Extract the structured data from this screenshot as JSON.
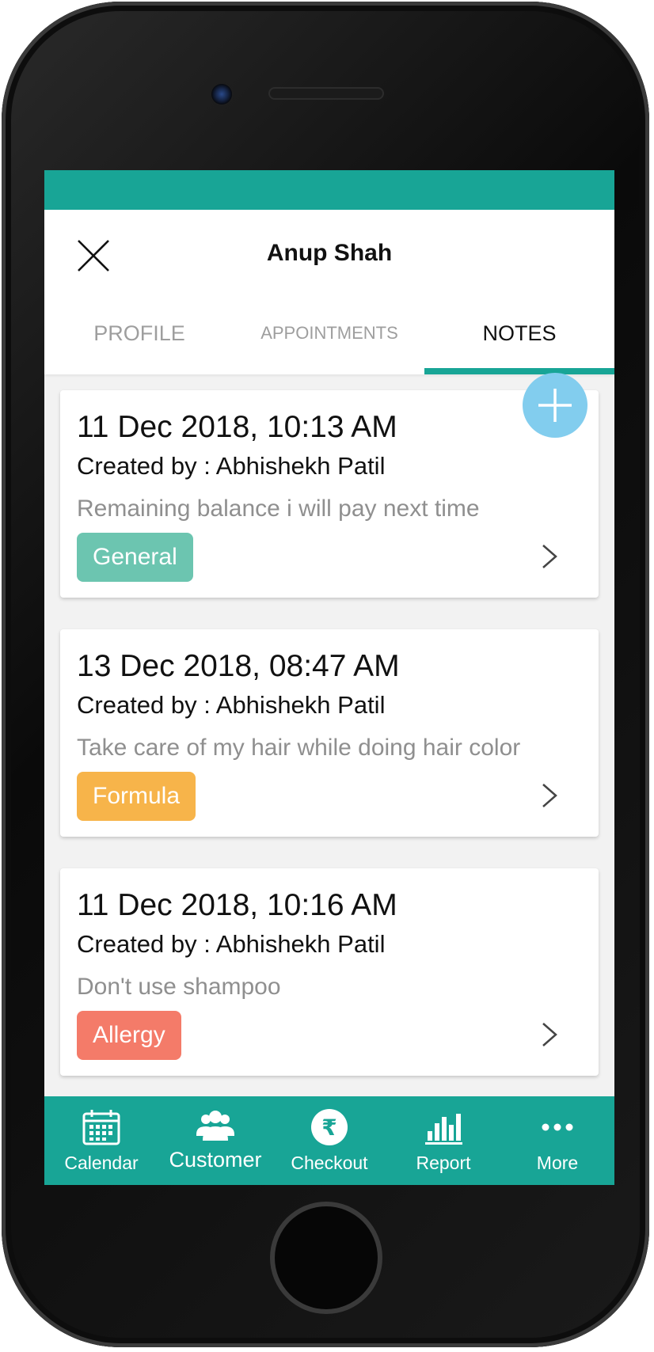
{
  "header": {
    "title": "Anup Shah",
    "close_icon": "close-icon"
  },
  "tabs": [
    {
      "label": "PROFILE",
      "active": false
    },
    {
      "label": "APPOINTMENTS",
      "active": false
    },
    {
      "label": "NOTES",
      "active": true
    }
  ],
  "notes": [
    {
      "date": "11 Dec 2018, 10:13 AM",
      "author": "Created by : Abhishekh Patil",
      "text": "Remaining balance i will pay next time",
      "tag": "General",
      "tag_color": "#6cc5b0"
    },
    {
      "date": "13 Dec 2018, 08:47 AM",
      "author": "Created by : Abhishekh Patil",
      "text": "Take care of my hair while doing hair color",
      "tag": "Formula",
      "tag_color": "#f7b44a"
    },
    {
      "date": "11 Dec 2018, 10:16 AM",
      "author": "Created by : Abhishekh Patil",
      "text": "Don't use shampoo",
      "tag": "Allergy",
      "tag_color": "#f47b69"
    }
  ],
  "fab": {
    "icon": "plus-icon",
    "color": "#82cdee"
  },
  "bottom_nav": [
    {
      "label": "Calendar",
      "icon": "calendar-icon"
    },
    {
      "label": "Customer",
      "icon": "customers-icon"
    },
    {
      "label": "Checkout",
      "icon": "rupee-icon"
    },
    {
      "label": "Report",
      "icon": "bar-chart-icon"
    },
    {
      "label": "More",
      "icon": "more-dots-icon"
    }
  ],
  "colors": {
    "accent": "#18a596",
    "background": "#f2f2f2"
  }
}
